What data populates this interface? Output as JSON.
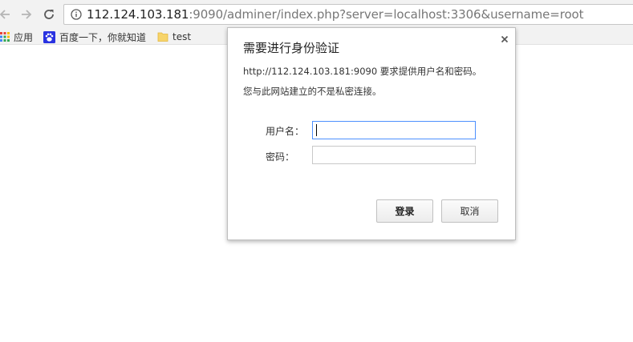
{
  "browser": {
    "url_host": "112.124.103.181",
    "url_rest": ":9090/adminer/index.php?server=localhost:3306&username=root",
    "back_icon": "arrow-left-icon",
    "forward_icon": "arrow-right-icon",
    "reload_icon": "reload-icon",
    "info_icon": "info-icon"
  },
  "bookmarks": [
    {
      "label": "应用",
      "icon": "apps-grid-icon"
    },
    {
      "label": "百度一下，你就知道",
      "icon": "baidu-paw-icon"
    },
    {
      "label": "test",
      "icon": "folder-icon"
    }
  ],
  "auth_dialog": {
    "title": "需要进行身份验证",
    "message_line1": "http://112.124.103.181:9090 要求提供用户名和密码。",
    "message_line2": "您与此网站建立的不是私密连接。",
    "username_label": "用户名：",
    "username_value": "",
    "password_label": "密码：",
    "password_value": "",
    "login_button": "登录",
    "cancel_button": "取消",
    "close_icon": "close-icon"
  },
  "colors": {
    "toolbar_bg": "#f2f2f2",
    "focus_border": "#4d90fe",
    "apps_icon_colors": [
      "#ea4335",
      "#fbbc05",
      "#34a853",
      "#4285f4"
    ],
    "baidu_blue": "#2932e1",
    "folder_yellow": "#f7d46a"
  }
}
